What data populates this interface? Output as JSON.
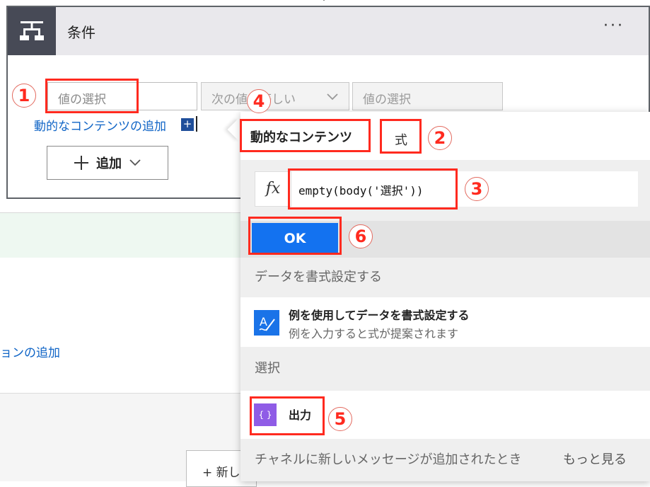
{
  "condition": {
    "title": "条件",
    "more": "···",
    "left_value_placeholder": "値の選択",
    "operator": "次の値に等しい",
    "right_value_placeholder": "値の選択",
    "dynamic_content_link": "動的なコンテンツの追加",
    "add_button": "追加"
  },
  "background": {
    "action_link": "ョンの追加",
    "new_step": "+ 新し"
  },
  "panel": {
    "tabs": [
      "動的なコンテンツ",
      "式"
    ],
    "fx_label": "fx",
    "expression": "empty(body('選択'))",
    "ok_label": "OK",
    "section_format": "データを書式設定する",
    "format_item": {
      "title": "例を使用してデータを書式設定する",
      "subtitle": "例を入力すると式が提案されます"
    },
    "section_select": "選択",
    "output_item": {
      "label": "出力"
    },
    "section_channel": "チャネルに新しいメッセージが追加されたとき",
    "see_more": "もっと見る"
  },
  "annotations": {
    "n1": "1",
    "n2": "2",
    "n3": "3",
    "n4": "4",
    "n5": "5",
    "n6": "6"
  },
  "colors": {
    "annotation_red": "#ff2a1f",
    "ok_blue": "#1372f0",
    "link_blue": "#0f64c6",
    "header_dark": "#474a56",
    "output_icon": "#8f5ce6"
  }
}
